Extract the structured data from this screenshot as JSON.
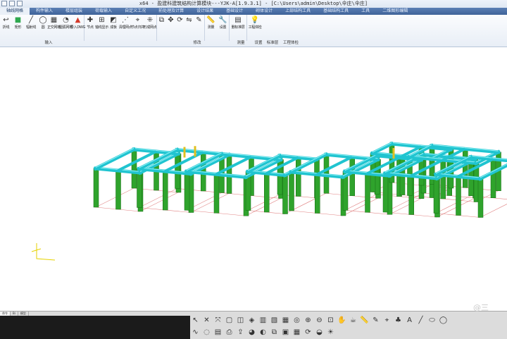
{
  "titlebar": {
    "title": "x64 - 盈建科建筑结构计算模块---YJK-A[1.9.3.1] - [C:\\Users\\admin\\Desktop\\伞庄\\伞庄]"
  },
  "tabs": [
    {
      "label": "轴线网格",
      "active": true
    },
    {
      "label": "构件输入"
    },
    {
      "label": "楼层组装"
    },
    {
      "label": "荷载输入"
    },
    {
      "label": "自定义工况"
    },
    {
      "label": "前处理及计算"
    },
    {
      "label": "设计结果"
    },
    {
      "label": "基础设计"
    },
    {
      "label": "砌体设计"
    },
    {
      "label": "上部结构工具"
    },
    {
      "label": "基础结构工具"
    },
    {
      "label": "工具"
    },
    {
      "label": "二维图形编辑"
    }
  ],
  "toolbar": {
    "items": [
      {
        "label": "折线",
        "icon": "polyline-icon",
        "glyph": "↩"
      },
      {
        "label": "矩形",
        "icon": "rectangle-icon",
        "glyph": "■"
      },
      {
        "label": "辐射线",
        "icon": "radial-line-icon",
        "glyph": "╱"
      },
      {
        "label": "圆",
        "icon": "circle-icon",
        "glyph": "◯"
      },
      {
        "label": "正交网格",
        "icon": "orthogonal-grid-icon",
        "glyph": "▦"
      },
      {
        "label": "圆弧网格",
        "icon": "arc-grid-icon",
        "glyph": "◔"
      },
      {
        "label": "导入DWG",
        "icon": "import-dwg-icon",
        "glyph": "▲"
      },
      {
        "label": "节点",
        "icon": "node-icon",
        "glyph": "✚"
      },
      {
        "label": "轴线显示",
        "icon": "axis-display-icon",
        "glyph": "⊞"
      },
      {
        "label": "成板",
        "icon": "slab-icon",
        "glyph": "◩"
      },
      {
        "label": "清理网点",
        "icon": "clean-grid-icon",
        "glyph": "⋰"
      },
      {
        "label": "节点归并",
        "icon": "node-merge-icon",
        "glyph": "⌖"
      },
      {
        "label": "形成网点",
        "icon": "form-grid-icon",
        "glyph": "⁜"
      },
      {
        "label": "",
        "icon": "copy-icon",
        "glyph": "⧉"
      },
      {
        "label": "",
        "icon": "move-icon",
        "glyph": "✥"
      },
      {
        "label": "",
        "icon": "rotate-icon",
        "glyph": "⟳"
      },
      {
        "label": "",
        "icon": "mirror-icon",
        "glyph": "⇋"
      },
      {
        "label": "",
        "icon": "erase-icon",
        "glyph": "✎"
      },
      {
        "label": "测量",
        "icon": "measure-icon",
        "glyph": "📏"
      },
      {
        "label": "设置",
        "icon": "settings-icon",
        "glyph": "🔧"
      },
      {
        "label": "删标准层",
        "icon": "delete-floor-icon",
        "glyph": "▤"
      },
      {
        "label": "工程体检",
        "icon": "project-check-icon",
        "glyph": "💡"
      }
    ],
    "groups": [
      "输入",
      "修改",
      "测量",
      "设置",
      "标准层",
      "工程体检"
    ]
  },
  "bottom_tabs": [
    "命令",
    "Bi",
    "模型"
  ],
  "bottom_tool_icons": [
    "select-icon",
    "cross-select-icon",
    "multi-select-icon",
    "window-icon",
    "box-icon",
    "cube-icon",
    "wall-icon",
    "slab-icon",
    "frame-icon",
    "ring-icon",
    "zoom-in-icon",
    "zoom-out-icon",
    "zoom-window-icon",
    "pan-icon",
    "teapot-icon",
    "ruler-icon",
    "pencil-icon",
    "node-icon",
    "tree-icon",
    "text-icon",
    "line-icon",
    "ellipse-icon",
    "circle-icon",
    "curve-icon",
    "hide-icon",
    "layer-icon",
    "print-icon",
    "export-icon",
    "color-icon",
    "palette-icon",
    "copy-icon",
    "paste-icon",
    "table-icon",
    "rotate-icon",
    "shade-icon",
    "light-icon"
  ],
  "watermark": "@三"
}
